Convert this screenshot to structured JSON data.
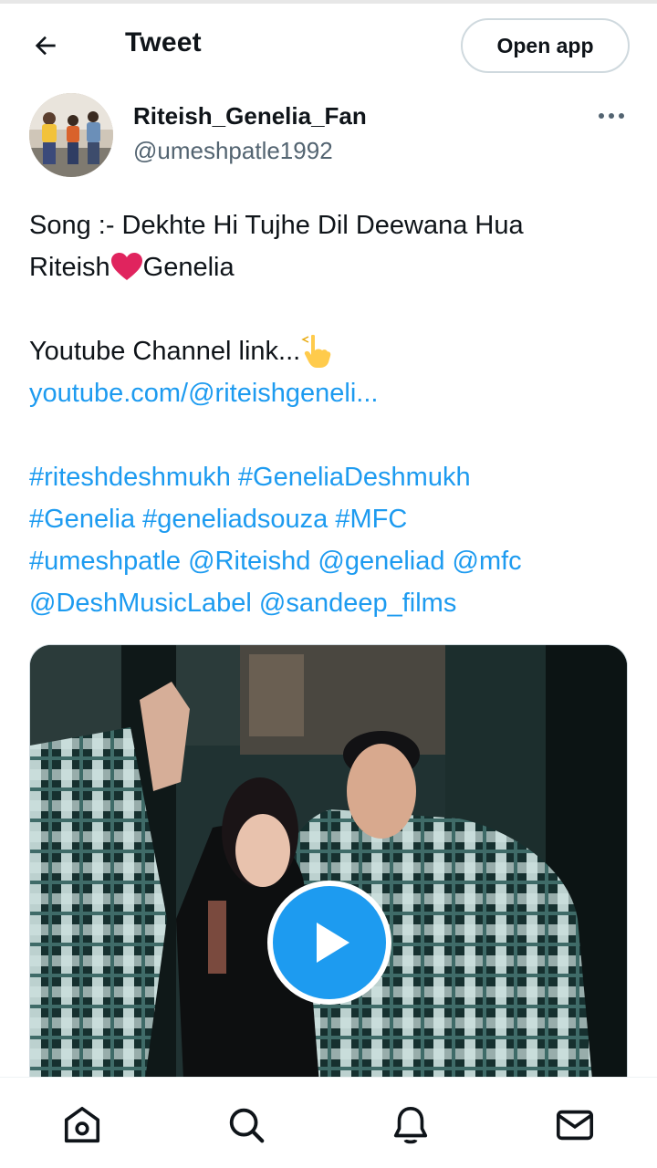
{
  "header": {
    "title": "Tweet",
    "open_app_label": "Open app",
    "back_icon": "arrow-left-icon"
  },
  "author": {
    "name": "Riteish_Genelia_Fan",
    "handle": "@umeshpatle1992",
    "more_icon": "more-horizontal-icon"
  },
  "tweet": {
    "line1": "Song :- Dekhte Hi Tujhe Dil Deewana Hua",
    "line2_a": "Riteish",
    "line2_b": "Genelia",
    "line3": "Youtube Channel link...",
    "link": "youtube.com/@riteishgeneli...",
    "tags_line1": "#riteshdeshmukh #GeneliaDeshmukh",
    "tags_line2": "#Genelia #geneliadsouza #MFC",
    "tags_line3": "#umeshpatle @Riteishd @geneliad @mfc",
    "tags_line4": "@DeshMusicLabel @sandeep_films"
  },
  "media": {
    "type": "video",
    "play_icon": "play-icon"
  },
  "bottom_nav": {
    "items": [
      "home-icon",
      "search-icon",
      "notifications-icon",
      "messages-icon"
    ]
  },
  "colors": {
    "link": "#1d9bf0",
    "text": "#0f1419",
    "secondary": "#536471",
    "heart": "#e0245e"
  }
}
